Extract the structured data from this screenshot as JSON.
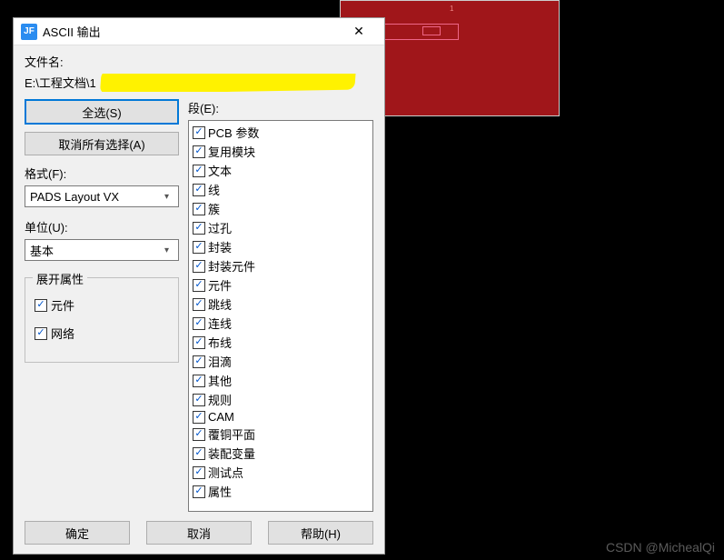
{
  "titlebar": {
    "icon_text": "JF",
    "title": "ASCII 输出",
    "close": "✕"
  },
  "file": {
    "label": "文件名:",
    "path": "E:\\工程文档\\1"
  },
  "buttons": {
    "select_all": "全选(S)",
    "deselect_all": "取消所有选择(A)",
    "ok": "确定",
    "cancel": "取消",
    "help": "帮助(H)"
  },
  "format": {
    "label": "格式(F):",
    "value": "PADS Layout VX"
  },
  "unit": {
    "label": "单位(U):",
    "value": "基本"
  },
  "expand": {
    "title": "展开属性",
    "items": [
      {
        "label": "元件",
        "checked": true
      },
      {
        "label": "网络",
        "checked": true
      }
    ]
  },
  "section": {
    "label": "段(E):",
    "items": [
      {
        "label": "PCB 参数",
        "checked": true
      },
      {
        "label": "复用模块",
        "checked": true
      },
      {
        "label": "文本",
        "checked": true
      },
      {
        "label": "线",
        "checked": true
      },
      {
        "label": "簇",
        "checked": true
      },
      {
        "label": "过孔",
        "checked": true
      },
      {
        "label": "封装",
        "checked": true
      },
      {
        "label": "封装元件",
        "checked": true
      },
      {
        "label": "元件",
        "checked": true
      },
      {
        "label": "跳线",
        "checked": true
      },
      {
        "label": "连线",
        "checked": true
      },
      {
        "label": "布线",
        "checked": true
      },
      {
        "label": "泪滴",
        "checked": true
      },
      {
        "label": "其他",
        "checked": true
      },
      {
        "label": "规则",
        "checked": true
      },
      {
        "label": "CAM",
        "checked": true
      },
      {
        "label": "覆铜平面",
        "checked": true
      },
      {
        "label": "装配变量",
        "checked": true
      },
      {
        "label": "测试点",
        "checked": true
      },
      {
        "label": "属性",
        "checked": true
      }
    ]
  },
  "watermark": "CSDN @MichealQi"
}
